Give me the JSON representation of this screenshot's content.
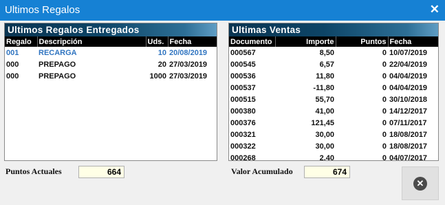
{
  "window": {
    "title": "Ultimos Regalos",
    "close_glyph": "✕"
  },
  "regalos": {
    "header": "Ultimos Regalos Entregados",
    "columns": [
      "Regalo",
      "Descripción",
      "Uds.",
      "Fecha"
    ],
    "rows": [
      {
        "regalo": "001",
        "descripcion": "RECARGA",
        "uds": "10",
        "fecha": "20/08/2019"
      },
      {
        "regalo": "000",
        "descripcion": "PREPAGO",
        "uds": "20",
        "fecha": "27/03/2019"
      },
      {
        "regalo": "000",
        "descripcion": "PREPAGO",
        "uds": "1000",
        "fecha": "27/03/2019"
      }
    ]
  },
  "ventas": {
    "header": "Ultimas Ventas",
    "columns": [
      "Documento",
      "Importe",
      "Puntos",
      "Fecha"
    ],
    "rows": [
      {
        "documento": "000567",
        "importe": "8,50",
        "puntos": "0",
        "fecha": "10/07/2019"
      },
      {
        "documento": "000545",
        "importe": "6,57",
        "puntos": "0",
        "fecha": "22/04/2019"
      },
      {
        "documento": "000536",
        "importe": "11,80",
        "puntos": "0",
        "fecha": "04/04/2019"
      },
      {
        "documento": "000537",
        "importe": "-11,80",
        "puntos": "0",
        "fecha": "04/04/2019"
      },
      {
        "documento": "000515",
        "importe": "55,70",
        "puntos": "0",
        "fecha": "30/10/2018"
      },
      {
        "documento": "000380",
        "importe": "41,00",
        "puntos": "0",
        "fecha": "14/12/2017"
      },
      {
        "documento": "000376",
        "importe": "121,45",
        "puntos": "0",
        "fecha": "07/11/2017"
      },
      {
        "documento": "000321",
        "importe": "30,00",
        "puntos": "0",
        "fecha": "18/08/2017"
      },
      {
        "documento": "000322",
        "importe": "30,00",
        "puntos": "0",
        "fecha": "18/08/2017"
      },
      {
        "documento": "000268",
        "importe": "2,40",
        "puntos": "0",
        "fecha": "04/07/2017"
      }
    ]
  },
  "footer": {
    "puntos_label": "Puntos Actuales",
    "puntos_value": "664",
    "valor_label": "Valor Acumulado",
    "valor_value": "674",
    "close_icon": "close-circle-icon",
    "close_glyph": "✕"
  },
  "colors": {
    "titlebar": "#1681d4",
    "selected_row": "#2f74c0",
    "value_box": "#ffffe6"
  }
}
